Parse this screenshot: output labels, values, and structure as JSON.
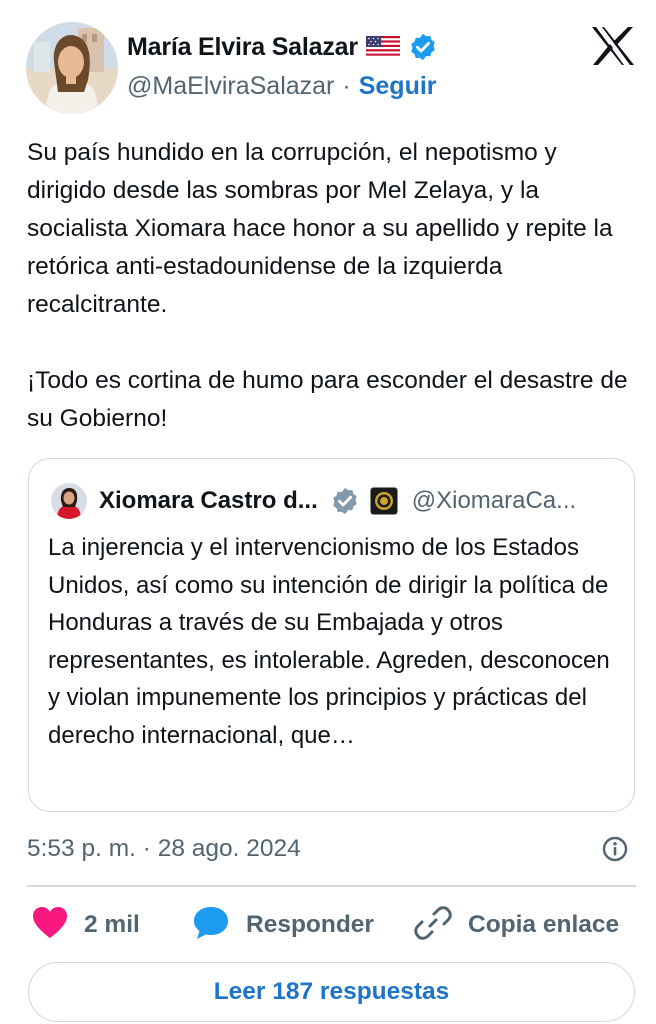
{
  "author": {
    "name": "María Elvira Salazar",
    "handle": "@MaElviraSalazar",
    "separator": "·",
    "follow_label": "Seguir",
    "flag_icon": "us-flag-icon",
    "verified_icon": "verified-badge-icon"
  },
  "platform_logo": "x-logo-icon",
  "tweet": {
    "paragraphs": [
      "Su país hundido en la corrupción, el nepotismo y dirigido desde las sombras por Mel Zelaya, y la socialista Xiomara hace honor a su apellido y repite la retórica anti-estadounidense de la izquierda recalcitrante.",
      "¡Todo es cortina de humo para esconder el desastre de su Gobierno!"
    ]
  },
  "quoted": {
    "name": "Xiomara Castro d...",
    "handle": "@XiomaraCa...",
    "verified_icon": "gray-verified-badge-icon",
    "affiliation_icon": "government-seal-icon",
    "text": "La injerencia y el intervencionismo de los Estados Unidos, así como su intención de dirigir la política de Honduras a través de su Embajada y otros representantes, es intolerable. Agreden, desconocen y violan impunemente los principios y prácticas del derecho internacional, que…"
  },
  "timestamp": "5:53 p. m. · 28 ago. 2024",
  "actions": {
    "likes": "2 mil",
    "reply": "Responder",
    "copy_link": "Copia enlace"
  },
  "read_replies": "Leer 187 respuestas",
  "colors": {
    "accent": "#1d74c9",
    "verified": "#1d9bf0",
    "like": "#f91880",
    "muted": "#536471",
    "border": "#cfd9de"
  }
}
